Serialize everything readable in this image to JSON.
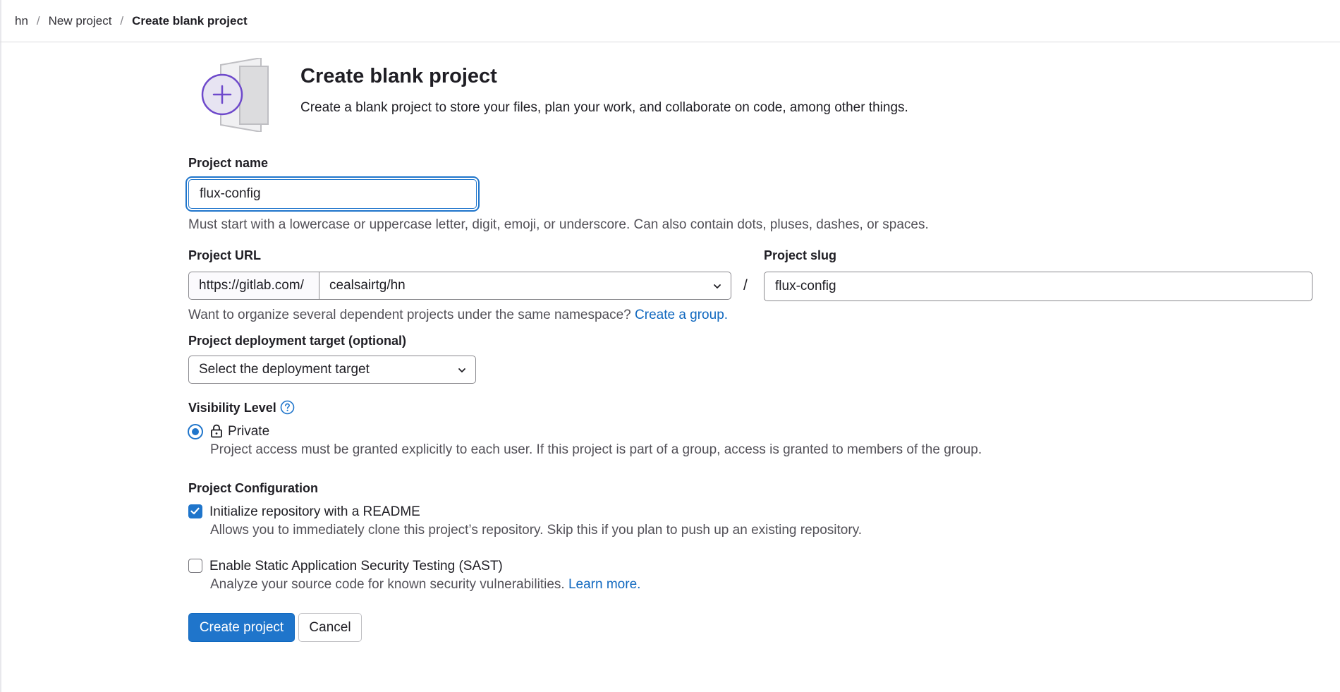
{
  "breadcrumb": {
    "items": [
      "hn",
      "New project",
      "Create blank project"
    ],
    "separator": "/"
  },
  "header": {
    "title": "Create blank project",
    "description": "Create a blank project to store your files, plan your work, and collaborate on code, among other things."
  },
  "project_name": {
    "label": "Project name",
    "value": "flux-config",
    "help": "Must start with a lowercase or uppercase letter, digit, emoji, or underscore. Can also contain dots, pluses, dashes, or spaces."
  },
  "project_url": {
    "label": "Project URL",
    "prefix": "https://gitlab.com/",
    "namespace": "cealsairtg/hn",
    "help_text": "Want to organize several dependent projects under the same namespace?",
    "help_link": "Create a group."
  },
  "slug": {
    "separator": "/",
    "label": "Project slug",
    "value": "flux-config"
  },
  "deployment": {
    "label": "Project deployment target (optional)",
    "selected": "Select the deployment target"
  },
  "visibility": {
    "label": "Visibility Level",
    "option_label": "Private",
    "option_icon": "lock-icon",
    "option_desc": "Project access must be granted explicitly to each user. If this project is part of a group, access is granted to members of the group."
  },
  "configuration": {
    "label": "Project Configuration",
    "readme": {
      "label": "Initialize repository with a README",
      "desc": "Allows you to immediately clone this project’s repository. Skip this if you plan to push up an existing repository.",
      "checked": true
    },
    "sast": {
      "label": "Enable Static Application Security Testing (SAST)",
      "desc": "Analyze your source code for known security vulnerabilities.",
      "link": "Learn more.",
      "checked": false
    }
  },
  "actions": {
    "create": "Create project",
    "cancel": "Cancel"
  },
  "colors": {
    "primary": "#1f75cb",
    "link": "#1068bf",
    "illustration_purple": "#6e49cb"
  }
}
